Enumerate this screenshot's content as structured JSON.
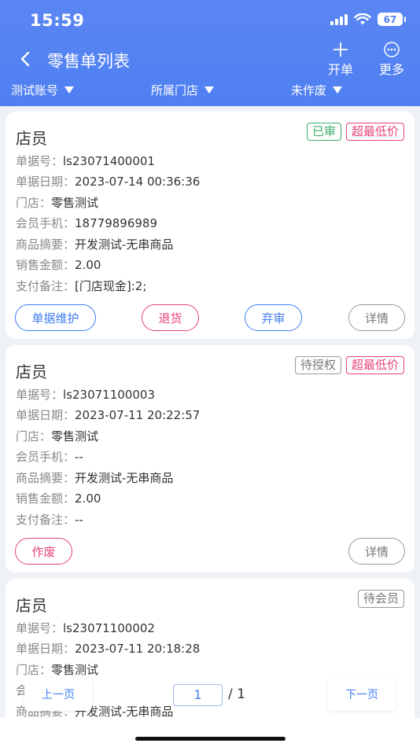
{
  "status_bar": {
    "time": "15:59",
    "battery": "67"
  },
  "nav": {
    "title": "零售单列表",
    "action_new": "开单",
    "action_more": "更多"
  },
  "filters": {
    "account": "测试账号",
    "store": "所属门店",
    "status": "未作废"
  },
  "labels": {
    "doc_no": "单据号：",
    "doc_date": "单据日期：",
    "store": "门店：",
    "member_phone": "会员手机：",
    "summary": "商品摘要：",
    "amount": "销售金额：",
    "payment": "支付备注："
  },
  "orders": [
    {
      "title": "店员",
      "tags": [
        "已审",
        "超最低价"
      ],
      "doc_no": "ls23071400001",
      "doc_date": "2023-07-14 00:36:36",
      "store": "零售测试",
      "member_phone": "18779896989",
      "summary": "开发测试-无串商品",
      "amount": "2.00",
      "payment": "[门店现金]:2;",
      "buttons": [
        "单据维护",
        "退货",
        "弃审",
        "详情"
      ]
    },
    {
      "title": "店员",
      "tags": [
        "待授权",
        "超最低价"
      ],
      "doc_no": "ls23071100003",
      "doc_date": "2023-07-11 20:22:57",
      "store": "零售测试",
      "member_phone": "--",
      "summary": "开发测试-无串商品",
      "amount": "2.00",
      "payment": "--",
      "buttons": [
        "作废",
        "详情"
      ]
    },
    {
      "title": "店员",
      "tags": [
        "待会员"
      ],
      "doc_no": "ls23071100002",
      "doc_date": "2023-07-11 20:18:28",
      "store": "零售测试",
      "member_phone": "--",
      "summary": "开发测试-无串商品"
    }
  ],
  "pager": {
    "prev": "上一页",
    "next": "下一页",
    "current": "1",
    "total": "/ 1"
  },
  "colors": {
    "header_blue": "#4f80f2",
    "accent_blue": "#3f7cf2",
    "pink": "#e5437a",
    "green": "#3db06a"
  }
}
